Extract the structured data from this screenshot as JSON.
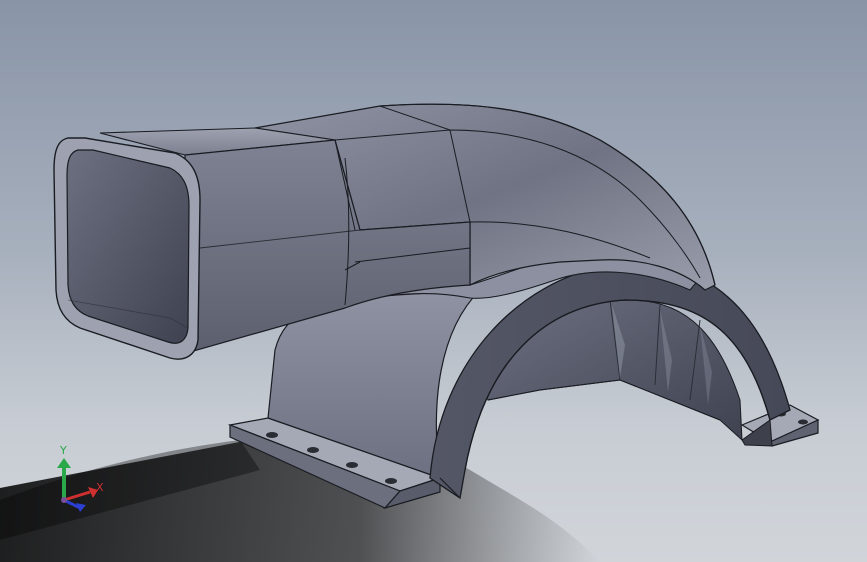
{
  "viewport": {
    "background_top": "#8994a7",
    "background_bottom": "#d1d5da"
  },
  "model": {
    "name": "",
    "part_color": "#7f8394",
    "part_dark": "#4a4d5a",
    "edge_color": "#1a1c22"
  },
  "triad": {
    "x_label": "X",
    "y_label": "Y",
    "x_color": "#d03030",
    "y_color": "#2aa84a",
    "z_color": "#2b3fd0"
  }
}
